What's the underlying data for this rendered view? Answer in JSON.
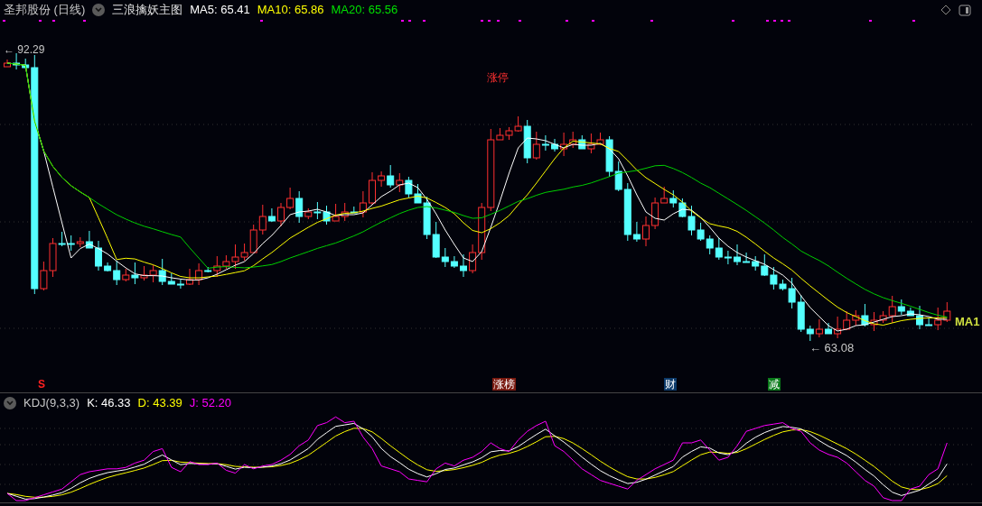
{
  "header": {
    "stock": "圣邦股份 (日线)",
    "indicator": "三浪擒妖主图",
    "ma": [
      {
        "label": "MA5: 65.41",
        "color": "#ffffff"
      },
      {
        "label": "MA10: 65.86",
        "color": "#ffff00"
      },
      {
        "label": "MA20: 65.56",
        "color": "#00e000"
      }
    ]
  },
  "price_chart": {
    "high_label": "← 92.29",
    "low_label": "← 63.08",
    "limit_up_label": "涨停",
    "line_label": "MA1"
  },
  "events": [
    {
      "text": "S",
      "kind": "plain",
      "color": "#ff2020"
    },
    {
      "text": "涨榜",
      "kind": "badge",
      "color": "#7a1a10"
    },
    {
      "text": "财",
      "kind": "badge",
      "color": "#0c3a6a"
    },
    {
      "text": "减",
      "kind": "badge",
      "color": "#0a7a1a"
    }
  ],
  "kdj": {
    "name": "KDJ(9,3,3)",
    "values": [
      {
        "label": "K: 46.33",
        "color": "#ffffff"
      },
      {
        "label": "D: 43.39",
        "color": "#ffff00"
      },
      {
        "label": "J: 52.20",
        "color": "#ff00ff"
      }
    ]
  }
}
